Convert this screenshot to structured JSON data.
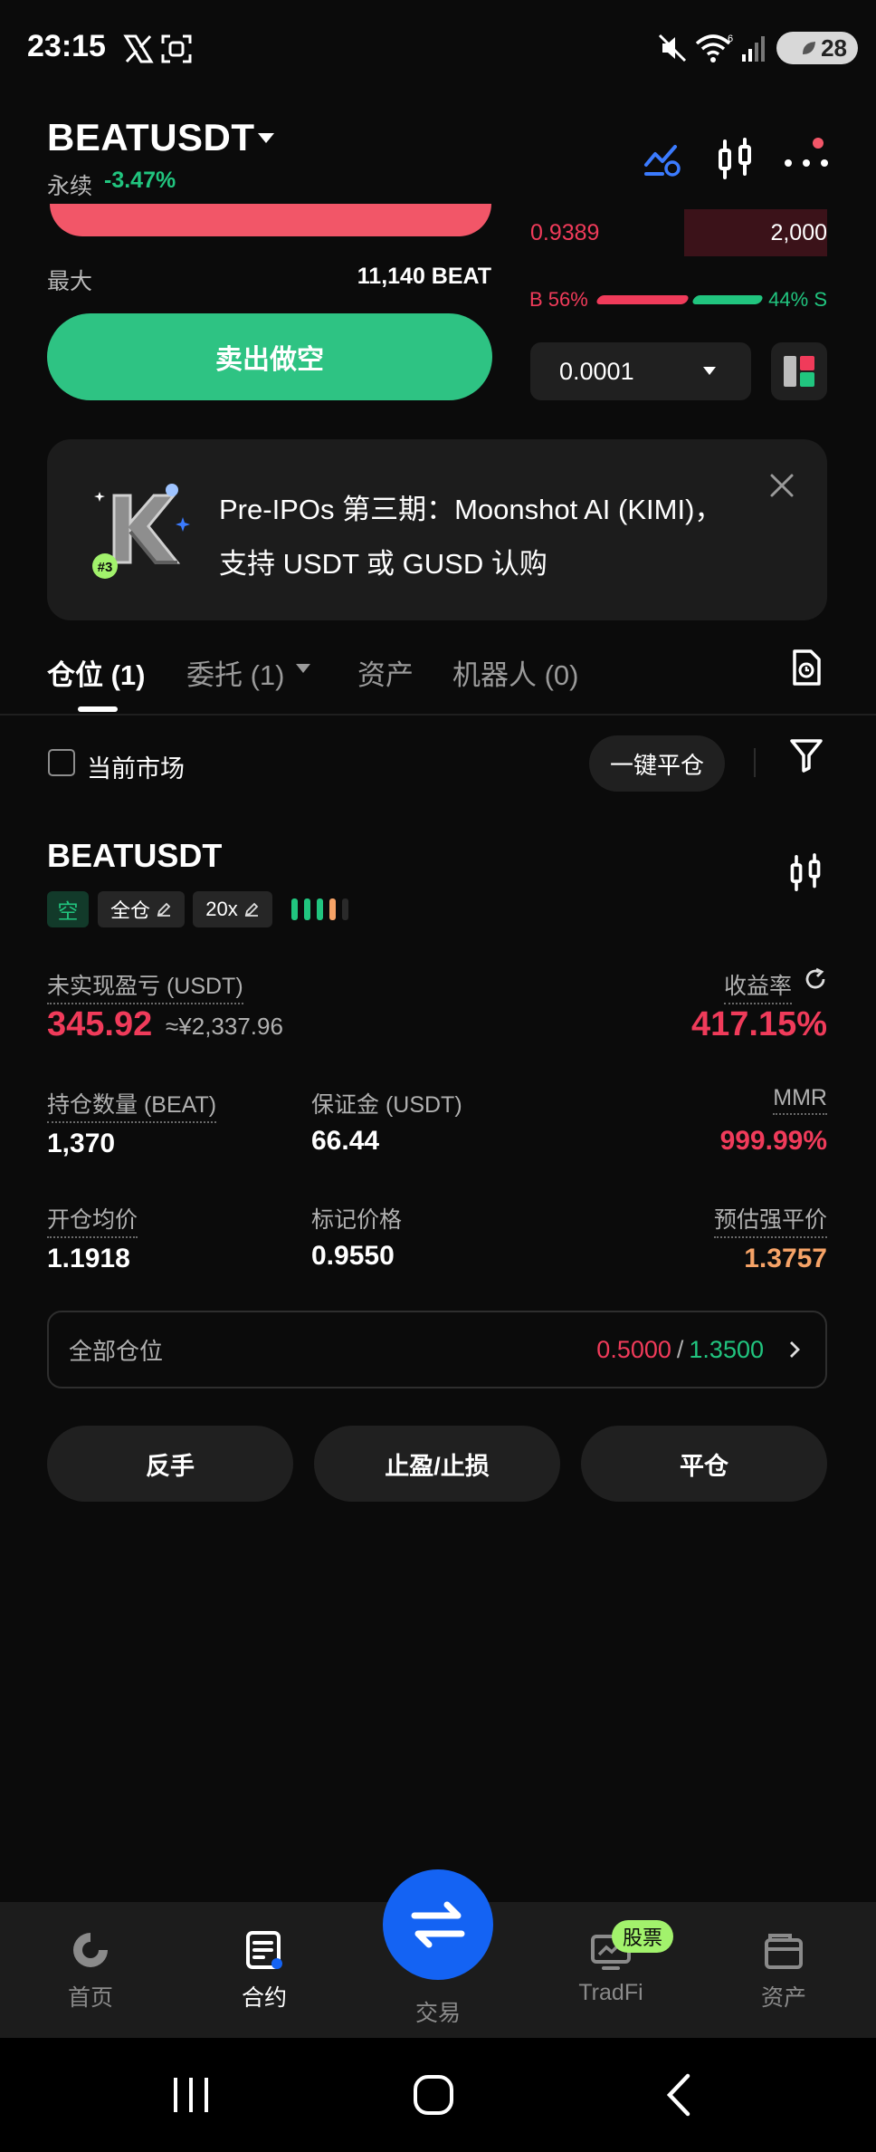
{
  "status_bar": {
    "time": "23:15",
    "battery": "28"
  },
  "header": {
    "pair": "BEATUSDT",
    "contract_type": "永续",
    "change_pct": "-3.47%"
  },
  "order_panel": {
    "max_label": "最大",
    "max_value": "11,140 BEAT",
    "sell_button": "卖出做空"
  },
  "order_book": {
    "ask_price": "0.9389",
    "ask_qty": "2,000",
    "buy_ratio": "B 56%",
    "sell_ratio": "44% S",
    "buy_ratio_value": 0.56,
    "tick_size": "0.0001"
  },
  "banner": {
    "badge": "#3",
    "line1": "Pre-IPOs 第三期：Moonshot AI (KIMI)，",
    "line2": "支持 USDT 或 GUSD 认购"
  },
  "tabs": {
    "positions": "仓位 (1)",
    "orders": "委托 (1)",
    "assets": "资产",
    "bots": "机器人 (0)"
  },
  "filter": {
    "current_market": "当前市场",
    "close_all": "一键平仓"
  },
  "position": {
    "symbol": "BEATUSDT",
    "side": "空",
    "margin_mode": "全仓",
    "leverage": "20x",
    "upl_label": "未实现盈亏 (USDT)",
    "upl_value": "345.92",
    "upl_fiat": "≈¥2,337.96",
    "roe_label": "收益率",
    "roe_value": "417.15%",
    "qty_label": "持仓数量 (BEAT)",
    "qty_value": "1,370",
    "margin_label": "保证金 (USDT)",
    "margin_value": "66.44",
    "mmr_label": "MMR",
    "mmr_value": "999.99%",
    "entry_label": "开仓均价",
    "entry_value": "1.1918",
    "mark_label": "标记价格",
    "mark_value": "0.9550",
    "liq_label": "预估强平价",
    "liq_value": "1.3757",
    "tpsl_label": "全部仓位",
    "tp_value": "0.5000",
    "tpsl_sep": "/",
    "sl_value": "1.3500"
  },
  "actions": {
    "reverse": "反手",
    "tpsl": "止盈/止损",
    "close": "平仓"
  },
  "bottom_nav": {
    "home": "首页",
    "futures": "合约",
    "trade": "交易",
    "tradfi": "TradFi",
    "tradfi_badge": "股票",
    "assets": "资产"
  },
  "colors": {
    "red": "#f03b5a",
    "green": "#21c57f",
    "accent_blue": "#1463f3",
    "orange": "#f6a367"
  }
}
